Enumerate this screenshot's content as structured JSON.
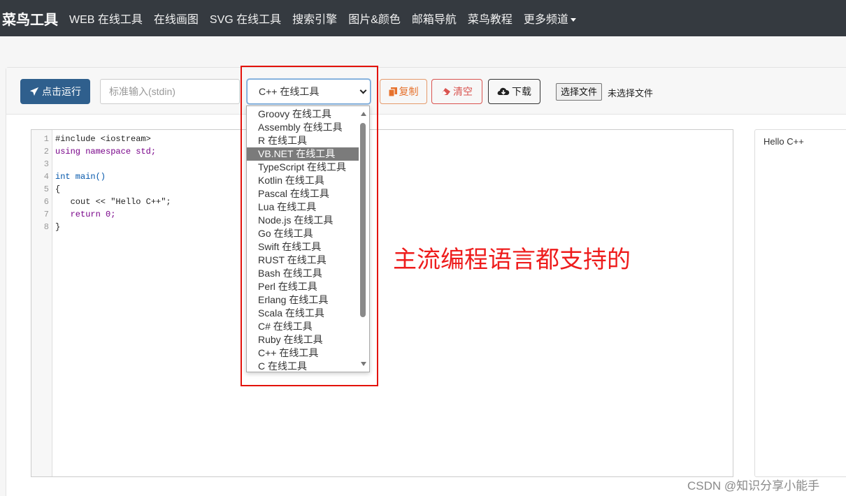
{
  "navbar": {
    "brand": "菜鸟工具",
    "links": [
      "WEB 在线工具",
      "在线画图",
      "SVG 在线工具",
      "搜索引擎",
      "图片&颜色",
      "邮箱导航",
      "菜鸟教程",
      "更多频道"
    ]
  },
  "toolbar": {
    "run_label": "点击运行",
    "stdin_placeholder": "标准输入(stdin)",
    "selected_language": "C++ 在线工具",
    "copy_label": "复制",
    "clear_label": "清空",
    "download_label": "下载",
    "file_button_label": "选择文件",
    "file_status": "未选择文件"
  },
  "editor": {
    "line_numbers": [
      "1",
      "2",
      "3",
      "4",
      "5",
      "6",
      "7",
      "8"
    ],
    "lines": [
      "#include <iostream>",
      "using namespace std;",
      "",
      "int main()",
      "{",
      "   cout << \"Hello C++\";",
      "   return 0;",
      "}"
    ]
  },
  "output": {
    "text": "Hello C++"
  },
  "dropdown": {
    "options": [
      "Groovy 在线工具",
      "Assembly 在线工具",
      "R 在线工具",
      "VB.NET 在线工具",
      "TypeScript 在线工具",
      "Kotlin 在线工具",
      "Pascal 在线工具",
      "Lua 在线工具",
      "Node.js 在线工具",
      "Go 在线工具",
      "Swift 在线工具",
      "RUST 在线工具",
      "Bash 在线工具",
      "Perl 在线工具",
      "Erlang 在线工具",
      "Scala 在线工具",
      "C# 在线工具",
      "Ruby 在线工具",
      "C++ 在线工具",
      "C 在线工具"
    ],
    "highlighted": "VB.NET 在线工具"
  },
  "annotation": {
    "text": "主流编程语言都支持的"
  },
  "watermark": "CSDN @知识分享小能手",
  "colors": {
    "navbar_bg": "#353a40",
    "run_button": "#2f5f8d",
    "copy_accent": "#e6722e",
    "clear_accent": "#d9534f",
    "annotation_red": "#ee1c1c"
  }
}
